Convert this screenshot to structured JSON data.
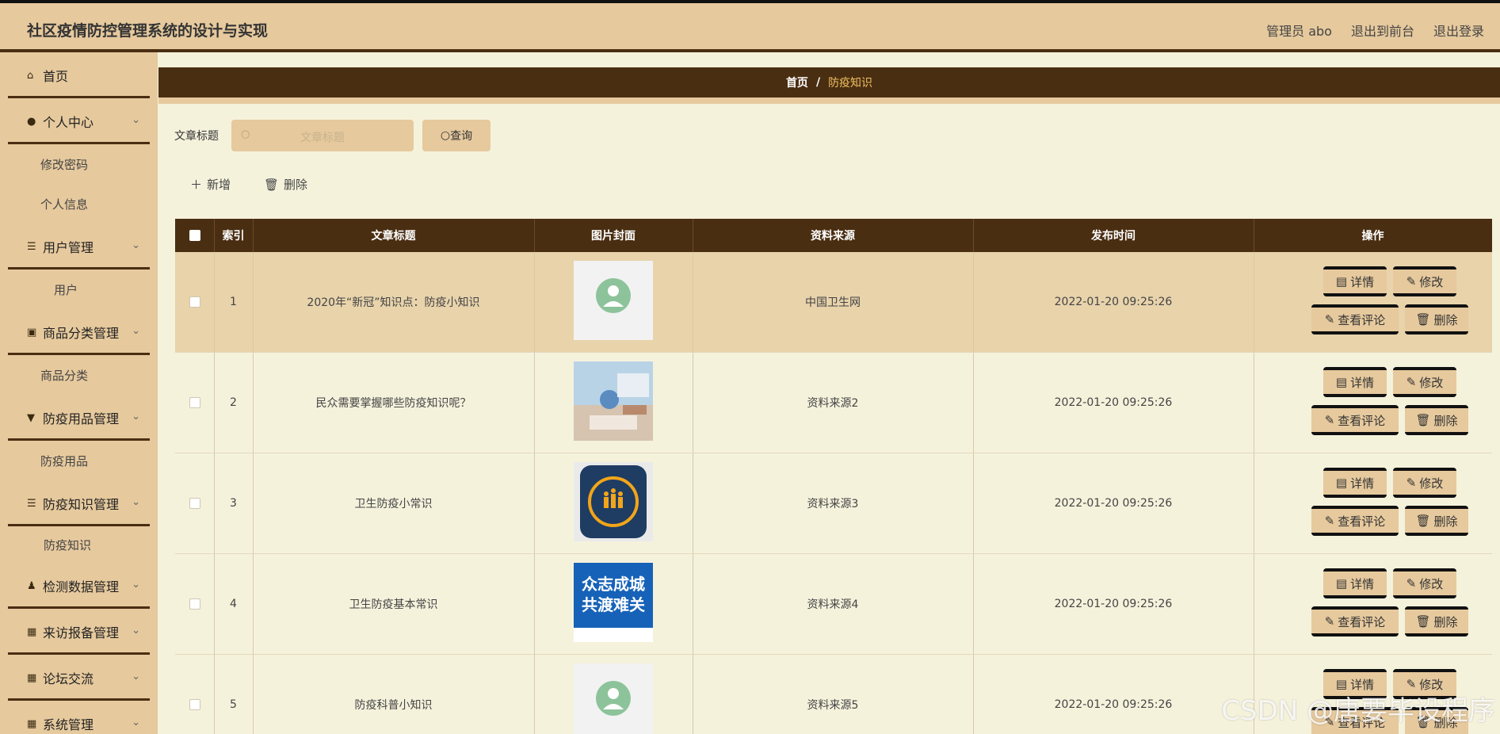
{
  "header": {
    "title": "社区疫情防控管理系统的设计与实现",
    "admin": "管理员 abo",
    "to_front": "退出到前台",
    "logout": "退出登录"
  },
  "sidebar": {
    "items": [
      {
        "label": "首页",
        "icon": "home-icon",
        "expandable": false
      },
      {
        "label": "个人中心",
        "icon": "user-icon",
        "expandable": true,
        "children": [
          "修改密码",
          "个人信息"
        ]
      },
      {
        "label": "用户管理",
        "icon": "list-icon",
        "expandable": true,
        "children": [
          "用户"
        ]
      },
      {
        "label": "商品分类管理",
        "icon": "clipboard-icon",
        "expandable": true,
        "children": [
          "商品分类"
        ]
      },
      {
        "label": "防疫用品管理",
        "icon": "brush-icon",
        "expandable": true,
        "children": [
          "防疫用品"
        ]
      },
      {
        "label": "防疫知识管理",
        "icon": "list-icon",
        "expandable": true,
        "children": [
          "防疫知识"
        ]
      },
      {
        "label": "检测数据管理",
        "icon": "person-icon",
        "expandable": true
      },
      {
        "label": "来访报备管理",
        "icon": "grid-icon",
        "expandable": true
      },
      {
        "label": "论坛交流",
        "icon": "grid-icon",
        "expandable": true
      },
      {
        "label": "系统管理",
        "icon": "grid-icon",
        "expandable": true
      }
    ]
  },
  "breadcrumb": {
    "home": "首页",
    "separator": "/",
    "current": "防疫知识"
  },
  "search": {
    "label": "文章标题",
    "placeholder": "文章标题",
    "button": "查询"
  },
  "toolbar": {
    "add": "新增",
    "delete": "删除"
  },
  "table": {
    "headers": [
      "索引",
      "文章标题",
      "图片封面",
      "资料来源",
      "发布时间",
      "操作"
    ],
    "rows": [
      {
        "index": "1",
        "title": "2020年“新冠”知识点：防疫小知识",
        "cover": "medical-badge",
        "source": "中国卫生网",
        "time": "2022-01-20 09:25:26"
      },
      {
        "index": "2",
        "title": "民众需要掌握哪些防疫知识呢？",
        "cover": "lab-photo",
        "source": "资料来源2",
        "time": "2022-01-20 09:25:26"
      },
      {
        "index": "3",
        "title": "卫生防疫小常识",
        "cover": "people-badge",
        "source": "资料来源3",
        "time": "2022-01-20 09:25:26"
      },
      {
        "index": "4",
        "title": "卫生防疫基本常识",
        "cover": "slogan-poster",
        "source": "资料来源4",
        "time": "2022-01-20 09:25:26"
      },
      {
        "index": "5",
        "title": "防疫科普小知识",
        "cover": "medical-badge",
        "source": "资料来源5",
        "time": "2022-01-20 09:25:26"
      }
    ],
    "actions": {
      "detail": "详情",
      "edit": "修改",
      "comments": "查看评论",
      "delete": "删除"
    }
  },
  "poster": {
    "line1": "众志成城",
    "line2": "共渡难关"
  },
  "watermark": "CSDN @唐要毕设程序",
  "colors": {
    "header": "#e6c99d",
    "dark": "#4a2e12",
    "bg": "#f5f2dc",
    "highlight_row": "#e8d3ab",
    "crumb_current": "#f0c060"
  }
}
